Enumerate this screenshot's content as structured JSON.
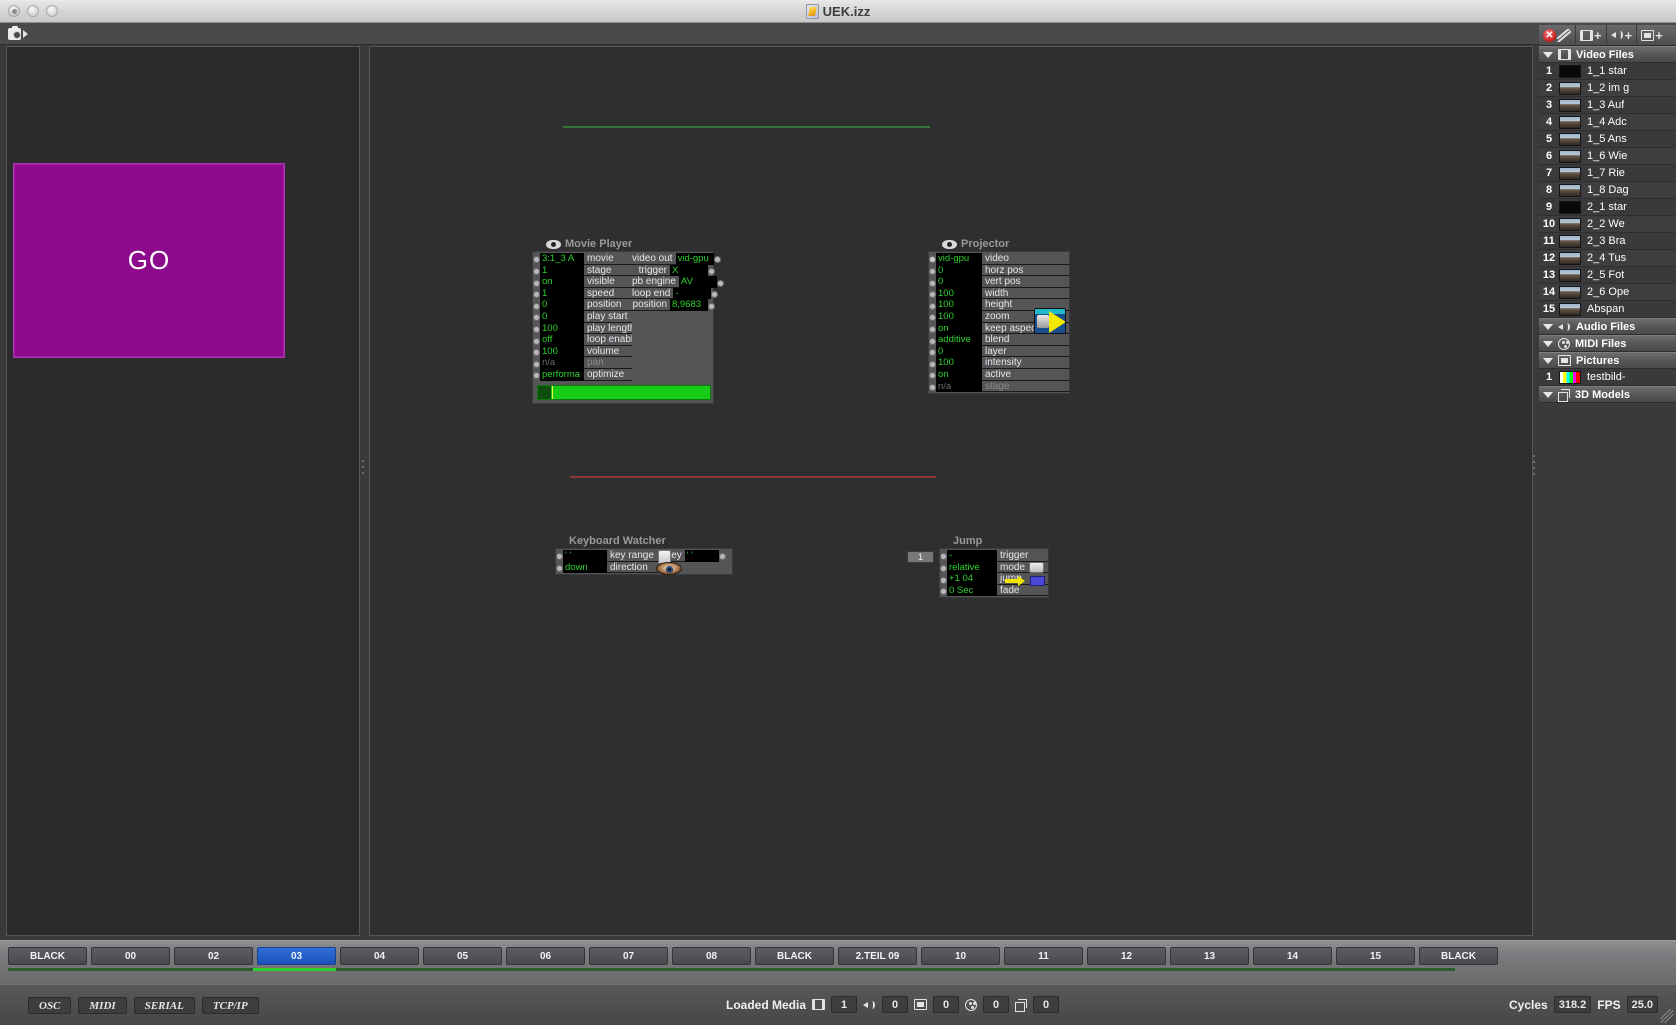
{
  "window": {
    "title": "UEK.izz",
    "doc_icon": "document-icon",
    "lights": [
      "close-button",
      "minimize-button",
      "zoom-button"
    ]
  },
  "toolstrip": {
    "camera_icon": "camera-icon",
    "camera_arrow_icon": "play-arrow-icon"
  },
  "preview": {
    "stage_label": "GO",
    "stage_color": "#8d0a8d"
  },
  "nodes": {
    "movie_player": {
      "title": "Movie Player",
      "eye_icon": "eye-icon",
      "inputs": [
        {
          "value": "3:1_3 A",
          "label": "movie"
        },
        {
          "value": "1",
          "label": "stage"
        },
        {
          "value": "on",
          "label": "visible"
        },
        {
          "value": "1",
          "label": "speed"
        },
        {
          "value": "0",
          "label": "position"
        },
        {
          "value": "0",
          "label": "play start"
        },
        {
          "value": "100",
          "label": "play length"
        },
        {
          "value": "off",
          "label": "loop enable"
        },
        {
          "value": "100",
          "label": "volume"
        },
        {
          "value": "n/a",
          "label": "pan",
          "dim": true
        },
        {
          "value": "performa",
          "label": "optimize"
        }
      ],
      "outputs": [
        {
          "label": "video out",
          "value": "vid-gpu"
        },
        {
          "label": "trigger",
          "value": "X"
        },
        {
          "label": "pb engine",
          "value": "AV"
        },
        {
          "label": "loop end",
          "value": "-"
        },
        {
          "label": "position",
          "value": "8,9683"
        }
      ],
      "progress_pct": 100
    },
    "projector": {
      "title": "Projector",
      "eye_icon": "eye-icon",
      "icon": "projector-icon",
      "inputs": [
        {
          "value": "vid-gpu",
          "label": "video"
        },
        {
          "value": "0",
          "label": "horz pos"
        },
        {
          "value": "0",
          "label": "vert pos"
        },
        {
          "value": "100",
          "label": "width"
        },
        {
          "value": "100",
          "label": "height"
        },
        {
          "value": "100",
          "label": "zoom"
        },
        {
          "value": "on",
          "label": "keep aspect"
        },
        {
          "value": "additive",
          "label": "blend"
        },
        {
          "value": "0",
          "label": "layer"
        },
        {
          "value": "100",
          "label": "intensity"
        },
        {
          "value": "on",
          "label": "active"
        },
        {
          "value": "n/a",
          "label": "stage",
          "dim": true
        }
      ]
    },
    "keyboard_watcher": {
      "title": "Keyboard Watcher",
      "key_icon": "keyboard-key-icon",
      "eye_icon": "eye-watcher-icon",
      "inputs": [
        {
          "value": "' '",
          "label": "key range"
        },
        {
          "value": "down",
          "label": "direction"
        }
      ],
      "outputs": [
        {
          "label": "key",
          "value": "' '"
        }
      ]
    },
    "jump": {
      "title": "Jump",
      "chip_value": "1",
      "mode_icon": "popup-menu-icon",
      "jump_arrow_icon": "jump-arrow-icon",
      "inputs": [
        {
          "value": "-",
          "label": "trigger"
        },
        {
          "value": "relative",
          "label": "mode"
        },
        {
          "value": "+1 04",
          "label": "jump"
        },
        {
          "value": "0 Sec",
          "label": "fade"
        }
      ]
    }
  },
  "media_bin": {
    "toolbar": [
      {
        "icon": "delete-icon",
        "name": "delete-media-button"
      },
      {
        "icon": "disable-icon",
        "name": "disable-media-button"
      },
      {
        "icon": "film-plus-icon",
        "name": "add-video-button"
      },
      {
        "icon": "speaker-plus-icon",
        "name": "add-audio-button"
      },
      {
        "icon": "picture-plus-icon",
        "name": "add-picture-button"
      }
    ],
    "sections": [
      {
        "label": "Video Files",
        "icon": "film-icon",
        "expanded": true,
        "items": [
          {
            "num": "1",
            "thumb": "black",
            "name": "1_1 star"
          },
          {
            "num": "2",
            "thumb": "city",
            "name": "1_2 im g"
          },
          {
            "num": "3",
            "thumb": "city",
            "name": "1_3 Auf"
          },
          {
            "num": "4",
            "thumb": "city",
            "name": "1_4 Adc"
          },
          {
            "num": "5",
            "thumb": "city",
            "name": "1_5 Ans"
          },
          {
            "num": "6",
            "thumb": "city",
            "name": "1_6 Wie"
          },
          {
            "num": "7",
            "thumb": "city",
            "name": "1_7 Rie"
          },
          {
            "num": "8",
            "thumb": "city",
            "name": "1_8 Dag"
          },
          {
            "num": "9",
            "thumb": "black",
            "name": "2_1 star"
          },
          {
            "num": "10",
            "thumb": "city",
            "name": "2_2 We"
          },
          {
            "num": "11",
            "thumb": "city",
            "name": "2_3 Bra"
          },
          {
            "num": "12",
            "thumb": "city",
            "name": "2_4 Tus"
          },
          {
            "num": "13",
            "thumb": "city",
            "name": "2_5 Fot"
          },
          {
            "num": "14",
            "thumb": "city",
            "name": "2_6 Ope"
          },
          {
            "num": "15",
            "thumb": "city",
            "name": "Abspan"
          }
        ]
      },
      {
        "label": "Audio Files",
        "icon": "speaker-icon",
        "expanded": true,
        "items": []
      },
      {
        "label": "MIDI Files",
        "icon": "midi-icon",
        "expanded": true,
        "items": []
      },
      {
        "label": "Pictures",
        "icon": "picture-icon",
        "expanded": true,
        "items": [
          {
            "num": "1",
            "thumb": "test",
            "name": "testbild-"
          }
        ]
      },
      {
        "label": "3D Models",
        "icon": "cube-icon",
        "expanded": true,
        "items": []
      }
    ]
  },
  "cue_bar": {
    "selected_index": 3,
    "buttons": [
      "BLACK",
      "00",
      "02",
      "03",
      "04",
      "05",
      "06",
      "07",
      "08",
      "BLACK",
      "2.TEIL 09",
      "10",
      "11",
      "12",
      "13",
      "14",
      "15",
      "BLACK"
    ]
  },
  "status_bar": {
    "protocols": [
      "OSC",
      "MIDI",
      "SERIAL",
      "TCP/IP"
    ],
    "loaded_media_label": "Loaded Media",
    "counts": [
      {
        "icon": "film-icon",
        "value": "1"
      },
      {
        "icon": "speaker-icon",
        "value": "0"
      },
      {
        "icon": "picture-icon",
        "value": "0"
      },
      {
        "icon": "midi-icon",
        "value": "0"
      },
      {
        "icon": "cube-icon",
        "value": "0"
      }
    ],
    "cycles_label": "Cycles",
    "cycles_value": "318.2",
    "fps_label": "FPS",
    "fps_value": "25.0"
  },
  "colors": {
    "accent_blue": "#2f6fd8",
    "value_green": "#2fd22f",
    "stage_magenta": "#8d0a8d",
    "wire_green": "#3c8c3c",
    "wire_red": "#b03a3a"
  }
}
